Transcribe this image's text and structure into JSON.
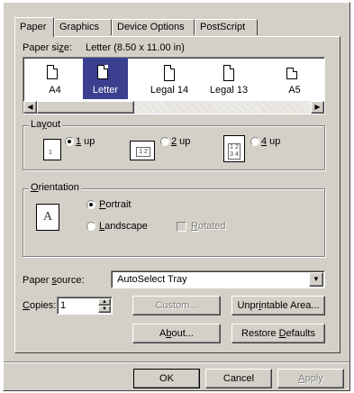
{
  "tabs": [
    {
      "label": "Paper"
    },
    {
      "label": "Graphics"
    },
    {
      "label": "Device Options"
    },
    {
      "label": "PostScript"
    }
  ],
  "paper": {
    "size_label_prefix": "Paper si",
    "size_label_hot": "z",
    "size_label_suffix": "e:",
    "size_value": "Letter (8.50 x 11.00 in)",
    "items": [
      {
        "label": "A4"
      },
      {
        "label": "Letter"
      },
      {
        "label": "Legal 14"
      },
      {
        "label": "Legal 13"
      },
      {
        "label": "A5"
      }
    ]
  },
  "layout": {
    "title_prefix": "La",
    "title_hot": "y",
    "title_suffix": "out",
    "options": [
      {
        "hot": "1",
        "rest": " up",
        "icon_text": "1",
        "selected": true
      },
      {
        "hot": "2",
        "rest": " up",
        "icon_text": "1 2",
        "selected": false
      },
      {
        "hot": "4",
        "rest": " up",
        "icon_text": "1 2 3 4",
        "selected": false
      }
    ]
  },
  "orientation": {
    "title_hot": "O",
    "title_rest": "rientation",
    "icon_letter": "A",
    "portrait_hot": "P",
    "portrait_rest": "ortrait",
    "landscape_hot": "L",
    "landscape_rest": "andscape",
    "rotated_hot": "R",
    "rotated_rest": "otated"
  },
  "source": {
    "label_prefix": "Paper ",
    "label_hot": "s",
    "label_suffix": "ource:",
    "value": "AutoSelect Tray"
  },
  "copies": {
    "label_hot": "C",
    "label_rest": "opies:",
    "value": "1"
  },
  "buttons": {
    "custom": "Custom...",
    "unprintable_prefix": "Unpr",
    "unprintable_hot": "i",
    "unprintable_suffix": "ntable Area...",
    "about_prefix": "A",
    "about_hot": "b",
    "about_suffix": "out...",
    "restore_prefix": "Restore ",
    "restore_hot": "D",
    "restore_suffix": "efaults",
    "ok": "OK",
    "cancel": "Cancel",
    "apply_hot": "A",
    "apply_rest": "pply"
  },
  "colors": {
    "face": "#d4d0c8",
    "selection": "#3b3f8f"
  }
}
